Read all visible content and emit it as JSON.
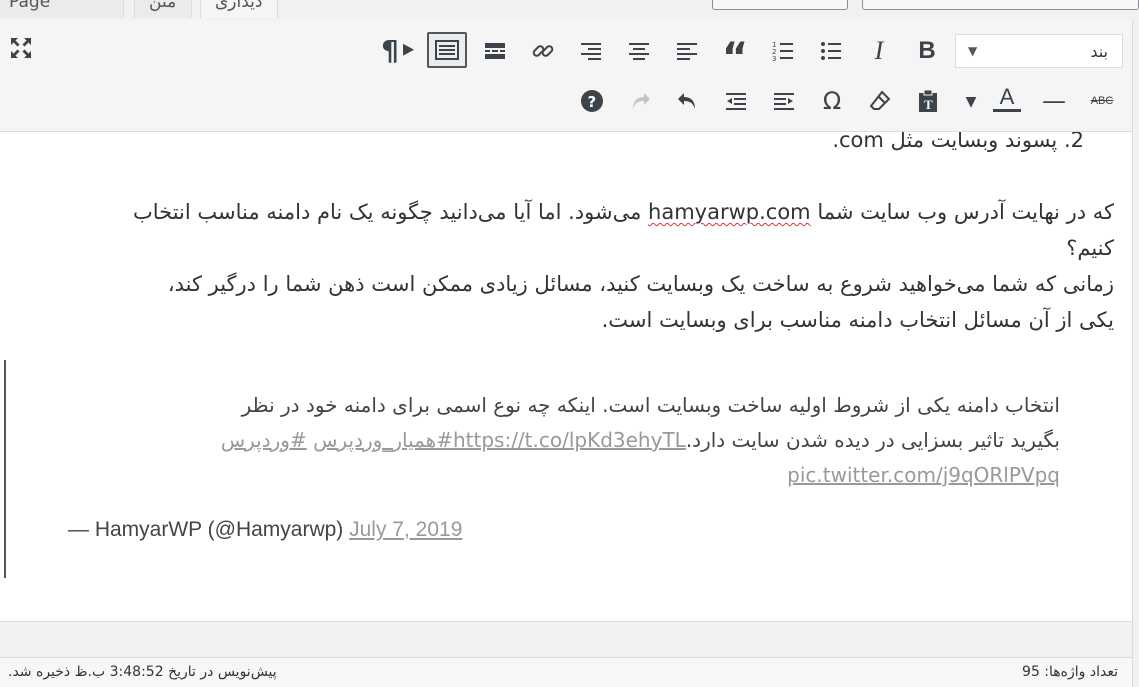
{
  "tabs": [
    {
      "label": "Page Builder"
    },
    {
      "label": "متن"
    },
    {
      "label": "دیداری"
    }
  ],
  "toolbar": {
    "format_select": "بند",
    "row1": [
      {
        "name": "bold-icon",
        "glyph": "B"
      },
      {
        "name": "italic-icon",
        "glyph": "I"
      },
      {
        "name": "bulleted-list-icon",
        "glyph": "list"
      },
      {
        "name": "numbered-list-icon",
        "glyph": "olist"
      },
      {
        "name": "blockquote-icon",
        "glyph": "“"
      },
      {
        "name": "align-left-icon",
        "glyph": "alignl"
      },
      {
        "name": "align-center-icon",
        "glyph": "alignc"
      },
      {
        "name": "align-right-icon",
        "glyph": "alignr"
      },
      {
        "name": "insert-link-icon",
        "glyph": "link"
      },
      {
        "name": "read-more-icon",
        "glyph": "more"
      },
      {
        "name": "toolbar-toggle-icon",
        "glyph": "kbd"
      },
      {
        "name": "rtl-direction-icon",
        "glyph": "¶"
      },
      {
        "name": "fullscreen-icon",
        "glyph": "full"
      }
    ],
    "row2": [
      {
        "name": "strikethrough-icon",
        "glyph": "ABC"
      },
      {
        "name": "horizontal-line-icon",
        "glyph": "—"
      },
      {
        "name": "text-color-icon",
        "glyph": "A"
      },
      {
        "name": "chevron-down-icon",
        "glyph": "▾"
      },
      {
        "name": "paste-text-icon",
        "glyph": "paste"
      },
      {
        "name": "clear-formatting-icon",
        "glyph": "eraser"
      },
      {
        "name": "special-character-icon",
        "glyph": "Ω"
      },
      {
        "name": "indent-icon",
        "glyph": "indent"
      },
      {
        "name": "outdent-icon",
        "glyph": "outdent"
      },
      {
        "name": "undo-icon",
        "glyph": "undo"
      },
      {
        "name": "redo-icon",
        "glyph": "redo"
      },
      {
        "name": "help-icon",
        "glyph": "?"
      }
    ]
  },
  "content": {
    "list_item_2": "2. پسوند وبسایت مثل com.",
    "para1_line1_a": "که در نهایت آدرس وب سایت شما ",
    "para1_domain": "hamyarwp.com",
    "para1_line1_b": " می‌شود. اما آیا می‌دانید چگونه یک نام دامنه مناسب انتخاب",
    "para1_line2": "کنیم؟",
    "para2_line1": "زمانی که شما می‌خواهید شروع به ساخت یک وبسایت کنید، مسائل زیادی ممکن است ذهن شما را درگیر کند،",
    "para2_line2": "یکی از آن مسائل انتخاب دامنه مناسب برای وبسایت است."
  },
  "tweet": {
    "line1": "انتخاب دامنه یکی از شروط اولیه ساخت وبسایت است. اینکه چه نوع اسمی برای دامنه خود در نظر",
    "line2_text": "بگیرید تاثیر بسزایی در دیده شدن سایت دارد.",
    "line2_link": "https://t.co/lpKd3ehyTL",
    "hashtag1": "#همیار_وردپرس",
    "hashtag2": "#وردپرس",
    "pic_link": "pic.twitter.com/j9qORlPVpq",
    "credit": "— HamyarWP (@Hamyarwp) ",
    "date": "July 7, 2019"
  },
  "status": {
    "word_count": "تعداد واژه‌ها: 95",
    "draft_saved": "پیش‌نویس در تاریخ 3:48:52 ب.ظ ذخیره شد."
  }
}
